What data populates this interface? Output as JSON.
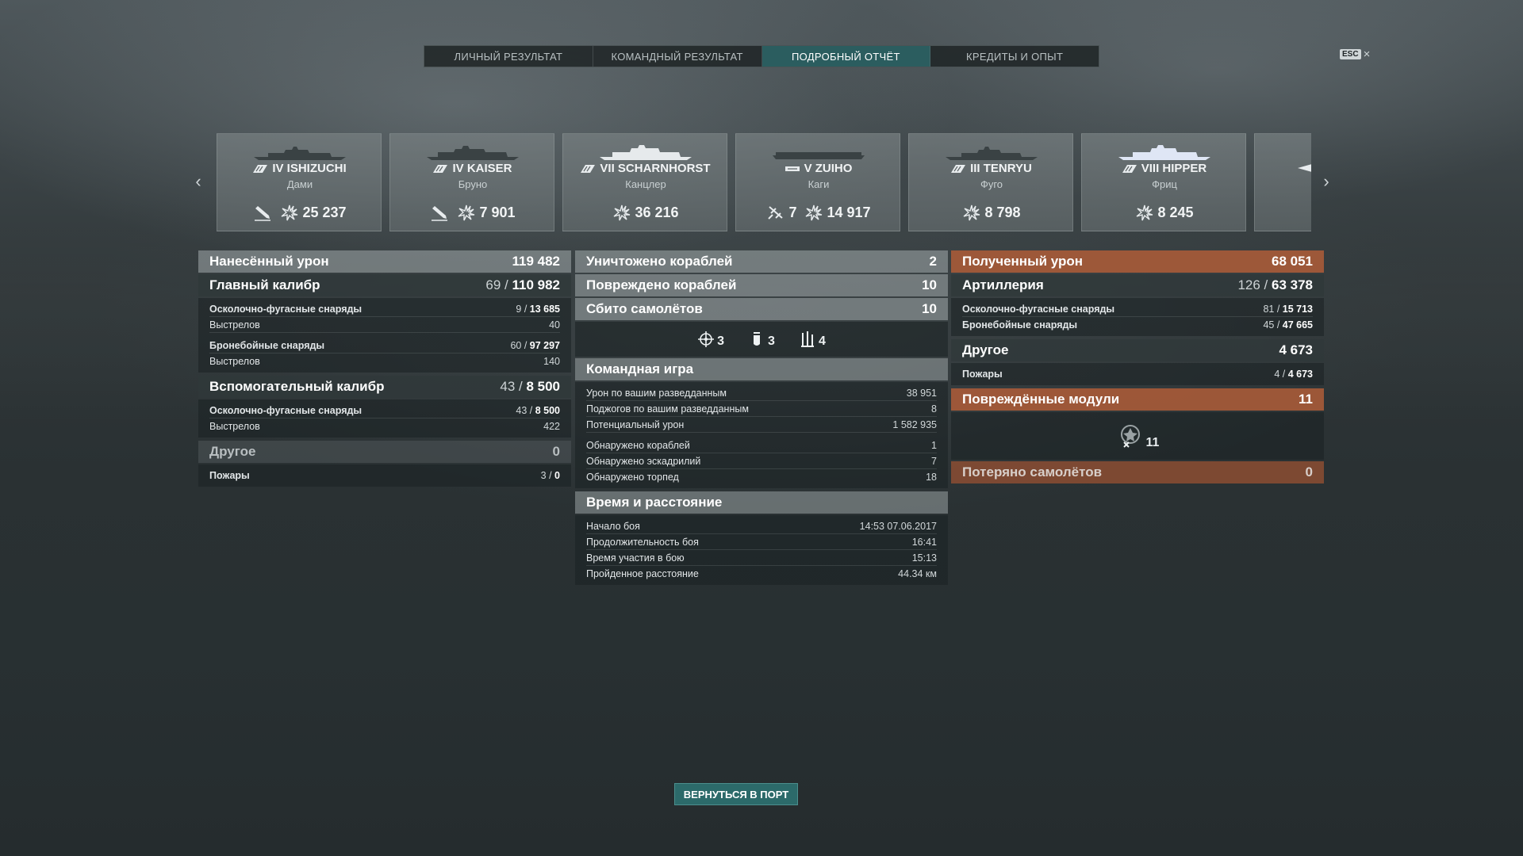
{
  "tabs": [
    {
      "label": "ЛИЧНЫЙ РЕЗУЛЬТАТ",
      "active": false
    },
    {
      "label": "КОМАНДНЫЙ РЕЗУЛЬТАТ",
      "active": false
    },
    {
      "label": "ПОДРОБНЫЙ ОТЧЁТ",
      "active": true
    },
    {
      "label": "КРЕДИТЫ И ОПЫТ",
      "active": false
    }
  ],
  "esc": {
    "key": "ESC",
    "close": "×"
  },
  "carousel": {
    "ships": [
      {
        "tier_name": "IV ISHIZUCHI",
        "player": "Дами",
        "icon1": "torpedo-icon",
        "val1": "",
        "value": "25 237"
      },
      {
        "tier_name": "IV KAISER",
        "player": "Бруно",
        "icon1": "torpedo-icon",
        "val1": "",
        "value": "7 901"
      },
      {
        "tier_name": "VII SCHARNHORST",
        "player": "Канцлер",
        "icon1": "",
        "val1": "",
        "value": "36 216"
      },
      {
        "tier_name": "V ZUIHO",
        "player": "Каги",
        "icon1": "plane-icon",
        "val1": "7",
        "value": "14 917"
      },
      {
        "tier_name": "III TENRYU",
        "player": "Фуго",
        "icon1": "",
        "val1": "",
        "value": "8 798"
      },
      {
        "tier_name": "VIII HIPPER",
        "player": "Фриц",
        "icon1": "",
        "val1": "",
        "value": "8 245"
      }
    ]
  },
  "left_panel": {
    "damage_dealt": {
      "label": "Нанесённый урон",
      "value": "119 482"
    },
    "main_battery": {
      "label": "Главный калибр",
      "hits": "69",
      "total": "110 982"
    },
    "main_rows_he": [
      {
        "label": "Осколочно-фугасные снаряды",
        "hits": "9",
        "dmg": "13 685"
      },
      {
        "label": "Выстрелов",
        "value": "40"
      }
    ],
    "main_rows_ap": [
      {
        "label": "Бронебойные снаряды",
        "hits": "60",
        "dmg": "97 297"
      },
      {
        "label": "Выстрелов",
        "value": "140"
      }
    ],
    "secondary": {
      "label": "Вспомогательный калибр",
      "hits": "43",
      "total": "8 500"
    },
    "secondary_rows": [
      {
        "label": "Осколочно-фугасные снаряды",
        "hits": "43",
        "dmg": "8 500"
      },
      {
        "label": "Выстрелов",
        "value": "422"
      }
    ],
    "other": {
      "label": "Другое",
      "value": "0"
    },
    "other_rows": [
      {
        "label": "Пожары",
        "hits": "3",
        "dmg": "0"
      }
    ]
  },
  "mid_panel": {
    "destroyed": {
      "label": "Уничтожено кораблей",
      "value": "2"
    },
    "damaged": {
      "label": "Повреждено кораблей",
      "value": "10"
    },
    "planes": {
      "label": "Сбито самолётов",
      "value": "10"
    },
    "plane_breakdown": [
      {
        "icon": "crosshair-icon",
        "value": "3"
      },
      {
        "icon": "bomb-icon",
        "value": "3"
      },
      {
        "icon": "torpedo-bomber-icon",
        "value": "4"
      }
    ],
    "teamplay": {
      "label": "Командная игра"
    },
    "teamplay_rows_a": [
      {
        "label": "Урон по вашим разведданным",
        "value": "38 951"
      },
      {
        "label": "Поджогов по вашим разведданным",
        "value": "8"
      },
      {
        "label": "Потенциальный урон",
        "value": "1 582 935"
      }
    ],
    "teamplay_rows_b": [
      {
        "label": "Обнаружено кораблей",
        "value": "1"
      },
      {
        "label": "Обнаружено эскадрилий",
        "value": "7"
      },
      {
        "label": "Обнаружено торпед",
        "value": "18"
      }
    ],
    "time": {
      "label": "Время и расстояние"
    },
    "time_rows": [
      {
        "label": "Начало боя",
        "value": "14:53  07.06.2017"
      },
      {
        "label": "Продолжительность боя",
        "value": "16:41"
      },
      {
        "label": "Время участия в бою",
        "value": "15:13"
      },
      {
        "label": "Пройденное расстояние",
        "value": "44.34 км"
      }
    ]
  },
  "right_panel": {
    "damage_received": {
      "label": "Полученный урон",
      "value": "68 051"
    },
    "artillery": {
      "label": "Артиллерия",
      "hits": "126",
      "total": "63 378"
    },
    "artillery_rows": [
      {
        "label": "Осколочно-фугасные снаряды",
        "hits": "81",
        "dmg": "15 713"
      },
      {
        "label": "Бронебойные снаряды",
        "hits": "45",
        "dmg": "47 665"
      }
    ],
    "other": {
      "label": "Другое",
      "value": "4 673"
    },
    "other_rows": [
      {
        "label": "Пожары",
        "hits": "4",
        "dmg": "4 673"
      }
    ],
    "modules": {
      "label": "Повреждённые модули",
      "value": "11"
    },
    "module_count": "11",
    "planes_lost": {
      "label": "Потеряно самолётов",
      "value": "0"
    }
  },
  "return_button": "ВЕРНУТЬСЯ В ПОРТ"
}
